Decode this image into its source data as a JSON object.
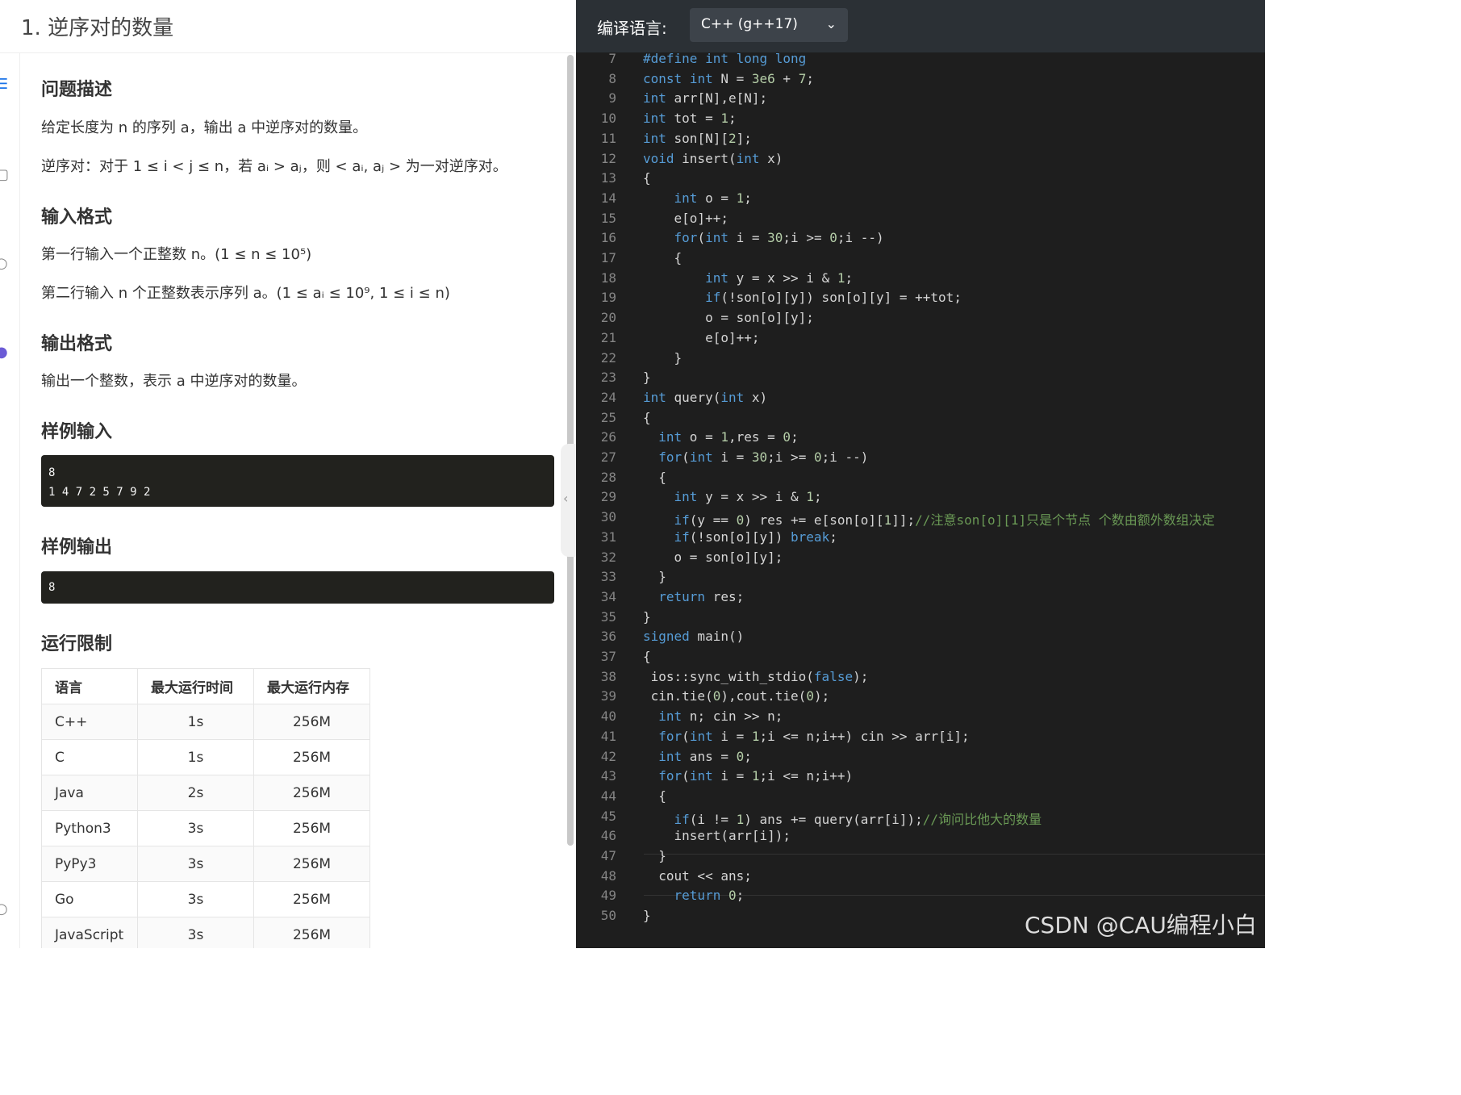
{
  "problem": {
    "title": "1. 逆序对的数量",
    "sections": {
      "desc_heading": "问题描述",
      "desc_line1": "给定长度为 n 的序列 a，输出 a 中逆序对的数量。",
      "desc_line2": "逆序对：对于 1 ≤ i < j ≤ n，若 aᵢ > aⱼ，则 < aᵢ, aⱼ > 为一对逆序对。",
      "input_heading": "输入格式",
      "input_line1": "第一行输入一个正整数 n。(1 ≤ n ≤ 10⁵)",
      "input_line2": "第二行输入 n 个正整数表示序列 a。(1 ≤ aᵢ ≤ 10⁹, 1 ≤ i ≤ n)",
      "output_heading": "输出格式",
      "output_line1": "输出一个整数，表示 a 中逆序对的数量。",
      "sample_in_heading": "样例输入",
      "sample_in": [
        "8",
        "1 4 7 2 5 7 9 2"
      ],
      "sample_out_heading": "样例输出",
      "sample_out": [
        "8"
      ],
      "limits_heading": "运行限制"
    },
    "limits_table": {
      "headers": [
        "语言",
        "最大运行时间",
        "最大运行内存"
      ],
      "rows": [
        [
          "C++",
          "1s",
          "256M"
        ],
        [
          "C",
          "1s",
          "256M"
        ],
        [
          "Java",
          "2s",
          "256M"
        ],
        [
          "Python3",
          "3s",
          "256M"
        ],
        [
          "PyPy3",
          "3s",
          "256M"
        ],
        [
          "Go",
          "3s",
          "256M"
        ],
        [
          "JavaScript",
          "3s",
          "256M"
        ]
      ]
    }
  },
  "editor": {
    "language_label": "编译语言:",
    "language_value": "C++ (g++17)",
    "watermark": "CSDN @CAU编程小白",
    "lines": [
      {
        "n": "7",
        "t": "#define int long long"
      },
      {
        "n": "8",
        "t": "const int N = 3e6 + 7;"
      },
      {
        "n": "9",
        "t": "int arr[N],e[N];"
      },
      {
        "n": "10",
        "t": "int tot = 1;"
      },
      {
        "n": "11",
        "t": "int son[N][2];"
      },
      {
        "n": "12",
        "t": "void insert(int x)"
      },
      {
        "n": "13",
        "t": "{"
      },
      {
        "n": "14",
        "t": "    int o = 1;"
      },
      {
        "n": "15",
        "t": "    e[o]++;"
      },
      {
        "n": "16",
        "t": "    for(int i = 30;i >= 0;i --)"
      },
      {
        "n": "17",
        "t": "    {"
      },
      {
        "n": "18",
        "t": "        int y = x >> i & 1;"
      },
      {
        "n": "19",
        "t": "        if(!son[o][y]) son[o][y] = ++tot;"
      },
      {
        "n": "20",
        "t": "        o = son[o][y];"
      },
      {
        "n": "21",
        "t": "        e[o]++;"
      },
      {
        "n": "22",
        "t": "    }"
      },
      {
        "n": "23",
        "t": "}"
      },
      {
        "n": "24",
        "t": "int query(int x)"
      },
      {
        "n": "25",
        "t": "{"
      },
      {
        "n": "26",
        "t": "  int o = 1,res = 0;"
      },
      {
        "n": "27",
        "t": "  for(int i = 30;i >= 0;i --)"
      },
      {
        "n": "28",
        "t": "  {"
      },
      {
        "n": "29",
        "t": "    int y = x >> i & 1;"
      },
      {
        "n": "30",
        "t": "    if(y == 0) res += e[son[o][1]];//注意son[o][1]只是个节点 个数由额外数组决定"
      },
      {
        "n": "31",
        "t": "    if(!son[o][y]) break;"
      },
      {
        "n": "32",
        "t": "    o = son[o][y];"
      },
      {
        "n": "33",
        "t": "  }"
      },
      {
        "n": "34",
        "t": "  return res;"
      },
      {
        "n": "35",
        "t": "}"
      },
      {
        "n": "36",
        "t": "signed main()"
      },
      {
        "n": "37",
        "t": "{"
      },
      {
        "n": "38",
        "t": " ios::sync_with_stdio(false);"
      },
      {
        "n": "39",
        "t": " cin.tie(0),cout.tie(0);"
      },
      {
        "n": "40",
        "t": "  int n; cin >> n;"
      },
      {
        "n": "41",
        "t": "  for(int i = 1;i <= n;i++) cin >> arr[i];"
      },
      {
        "n": "42",
        "t": "  int ans = 0;"
      },
      {
        "n": "43",
        "t": "  for(int i = 1;i <= n;i++)"
      },
      {
        "n": "44",
        "t": "  {"
      },
      {
        "n": "45",
        "t": "    if(i != 1) ans += query(arr[i]);//询问比他大的数量"
      },
      {
        "n": "46",
        "t": "    insert(arr[i]);"
      },
      {
        "n": "47",
        "t": "  }"
      },
      {
        "n": "48",
        "t": "  cout << ans;"
      },
      {
        "n": "49",
        "t": "    return 0;"
      },
      {
        "n": "50",
        "t": "}"
      }
    ]
  }
}
